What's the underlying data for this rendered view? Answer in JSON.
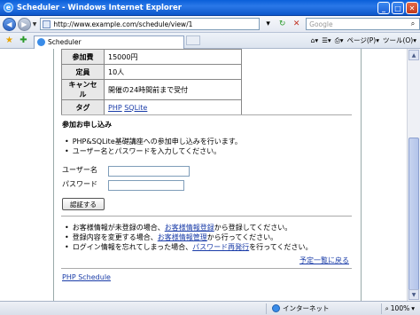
{
  "window": {
    "title": "Scheduler - Windows Internet Explorer",
    "minimize": "_",
    "maximize": "□",
    "close": "✕"
  },
  "address": {
    "url": "http://www.example.com/schedule/view/1",
    "search_placeholder": "Google"
  },
  "tab": {
    "label": "Scheduler"
  },
  "toolbar": {
    "page_label": "ページ(P)",
    "tools_label": "ツール(O)"
  },
  "info_table": [
    {
      "key": "参加費",
      "value": "15000円"
    },
    {
      "key": "定員",
      "value": "10人"
    },
    {
      "key": "キャンセル",
      "value": "開催の24時間前まで受付"
    },
    {
      "key": "タグ",
      "tags": [
        "PHP",
        "SQLite"
      ]
    }
  ],
  "signup": {
    "heading": "参加お申し込み",
    "notes": [
      "PHP&SQLite基礎講座への参加申し込みを行います。",
      "ユーザー名とパスワードを入力してください。"
    ],
    "username_label": "ユーザー名",
    "password_label": "パスワード",
    "submit_label": "認証する"
  },
  "help": [
    {
      "before": "お客様情報が未登録の場合、",
      "link": "お客様情報登録",
      "after": "から登録してください。"
    },
    {
      "before": "登録内容を変更する場合、",
      "link": "お客様情報管理",
      "after": "から行ってください。"
    },
    {
      "before": "ログイン情報を忘れてしまった場合、",
      "link": "パスワード再発行",
      "after": "を行ってください。"
    }
  ],
  "back_link": "予定一覧に戻る",
  "footer_link": "PHP Schedule",
  "status": {
    "zone": "インターネット",
    "zoom": "100%"
  }
}
